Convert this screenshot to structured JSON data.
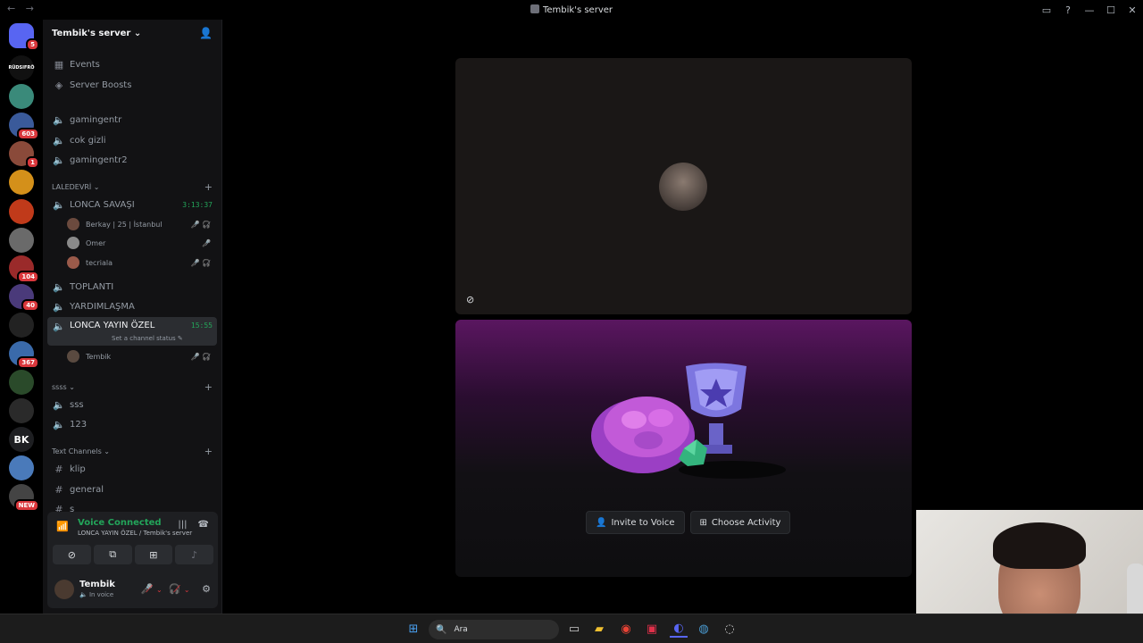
{
  "window": {
    "title": "Tembik's server",
    "nav_back": "←",
    "nav_forward": "→",
    "controls": [
      "▭",
      "?",
      "—",
      "☐",
      "✕"
    ]
  },
  "servers": [
    {
      "label": "",
      "badge": "5",
      "color": "#5865f2"
    },
    {
      "label": "RÜDSIFRÖ",
      "badge": "",
      "color": "#111"
    },
    {
      "label": "",
      "badge": "",
      "color": "#3a8a7a"
    },
    {
      "label": "",
      "badge": "603",
      "color": "#3a5a9a"
    },
    {
      "label": "",
      "badge": "1",
      "color": "#8a4a3a"
    },
    {
      "label": "",
      "badge": "",
      "color": "#d4901a"
    },
    {
      "label": "",
      "badge": "",
      "color": "#c03a1a"
    },
    {
      "label": "",
      "badge": "",
      "color": "#6a6a6a"
    },
    {
      "label": "",
      "badge": "104",
      "color": "#9a2a2a"
    },
    {
      "label": "",
      "badge": "40",
      "color": "#4a3a7a"
    },
    {
      "label": "",
      "badge": "",
      "color": "#222"
    },
    {
      "label": "",
      "badge": "367",
      "color": "#3a6aaa"
    },
    {
      "label": "",
      "badge": "",
      "color": "#2a4a2a"
    },
    {
      "label": "",
      "badge": "",
      "color": "#2a2a2a"
    },
    {
      "label": "BK",
      "badge": "",
      "color": "#1e1f22"
    },
    {
      "label": "",
      "badge": "",
      "color": "#4a7aba"
    },
    {
      "label": "",
      "badge": "NEW",
      "color": "#444"
    }
  ],
  "sidebar": {
    "server_name": "Tembik's server",
    "events": "Events",
    "boosts": "Server Boosts",
    "voice_top": [
      "gamingentr",
      "cok gizli",
      "gamingentr2"
    ],
    "cat1": "LALEDEVRİ",
    "lonca_savasi": {
      "name": "LONCA SAVAŞI",
      "time": "3:13:37"
    },
    "lonca_users": [
      {
        "name": "Berkay | 25 | İstanbul",
        "status": "🎤̸ 🎧̸"
      },
      {
        "name": "Omer",
        "status": "🎤̸"
      },
      {
        "name": "tecriala",
        "status": "🎤̸ 🎧̸"
      }
    ],
    "toplanti": "TOPLANTI",
    "yardim": "YARDIMLAŞMA",
    "lonca_yayin": {
      "name": "LONCA YAYIN ÖZEL",
      "time": "15:55",
      "sub": "Set a channel status ✎"
    },
    "yayin_user": {
      "name": "Tembik",
      "status": "🎤̸ 🎧̸"
    },
    "cat2": "ssss",
    "voice_ss": [
      "sss",
      "123"
    ],
    "cat3": "Text Channels",
    "text_channels": [
      "klip",
      "general",
      "s"
    ]
  },
  "voice": {
    "title": "Voice Connected",
    "sub": "LONCA YAYIN ÖZEL / Tembik's server"
  },
  "user": {
    "name": "Tembik",
    "status": "In voice"
  },
  "stage": {
    "invite": "Invite to Voice",
    "activity": "Choose Activity"
  },
  "taskbar": {
    "search": "Ara"
  }
}
